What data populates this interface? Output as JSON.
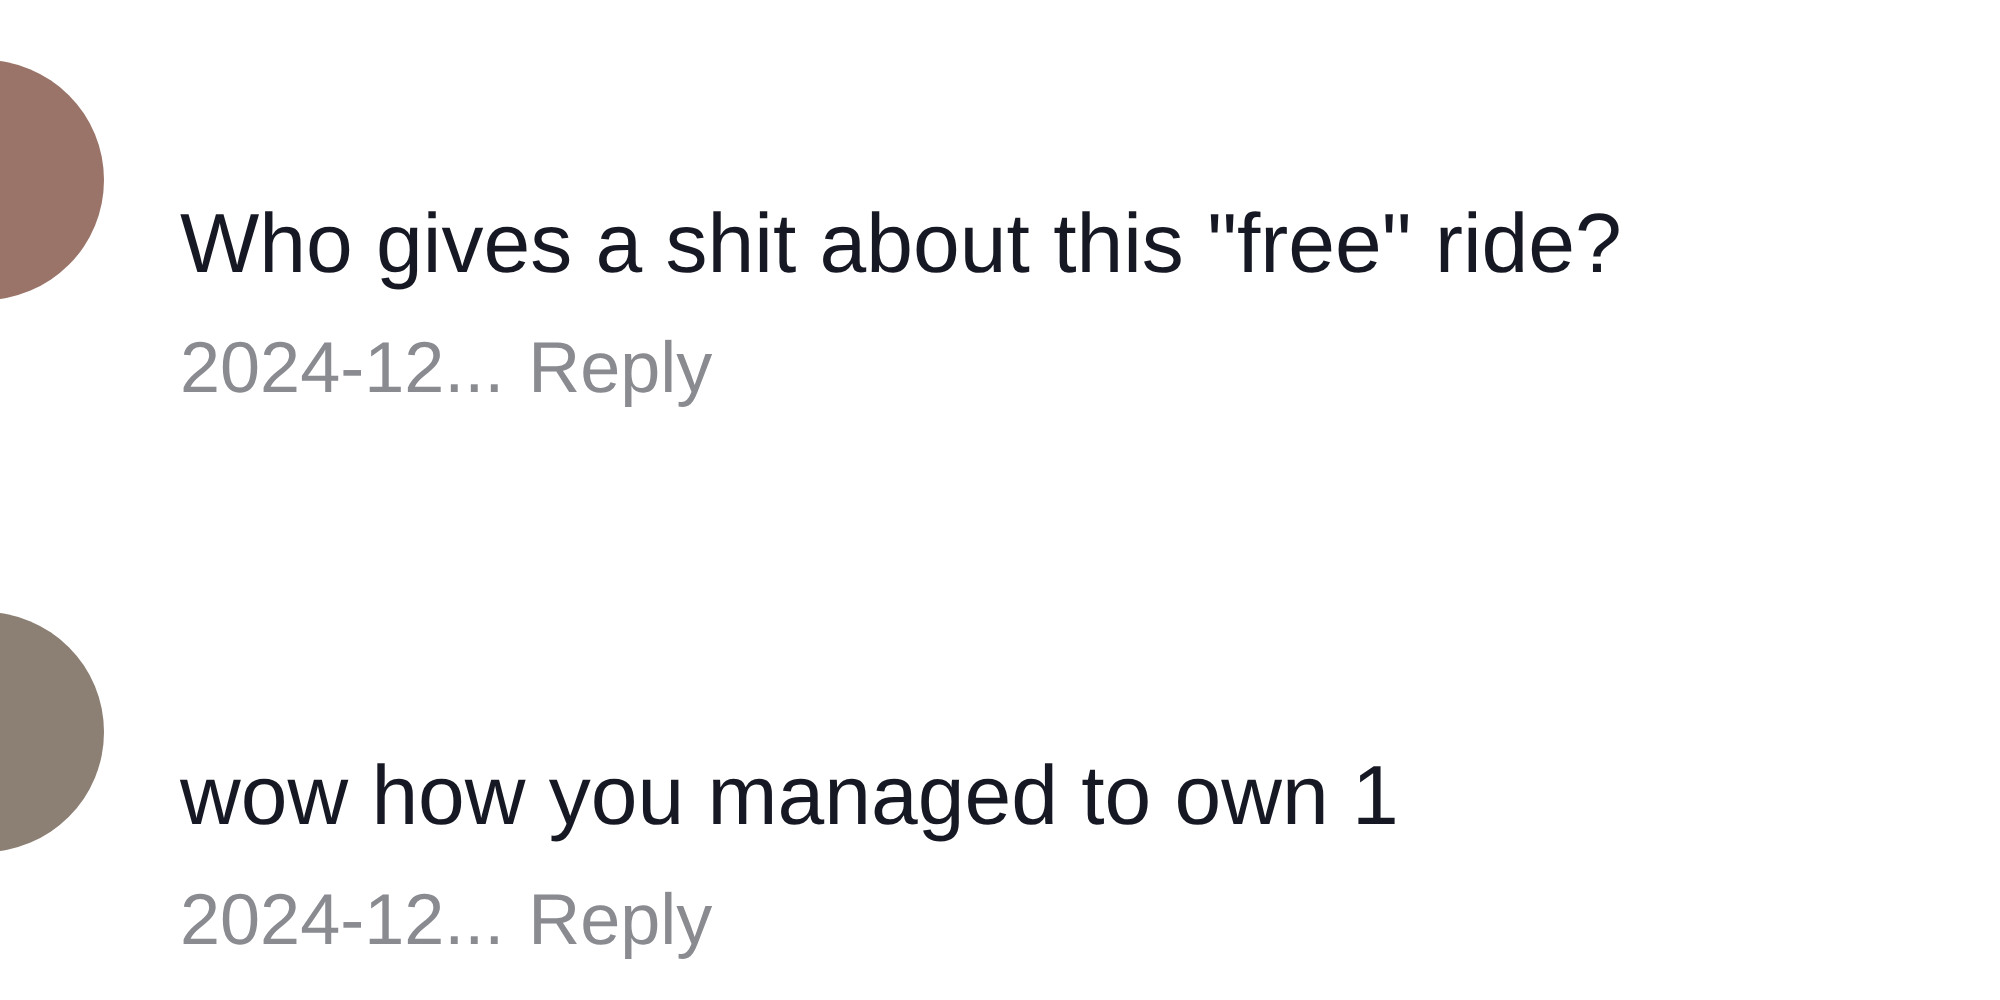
{
  "comments": [
    {
      "text": "Who gives a shit about this \"free\" ride?",
      "date": "2024-12...",
      "reply": "Reply"
    },
    {
      "text": "wow how you managed to own 1",
      "date": "2024-12...",
      "reply": "Reply"
    }
  ]
}
